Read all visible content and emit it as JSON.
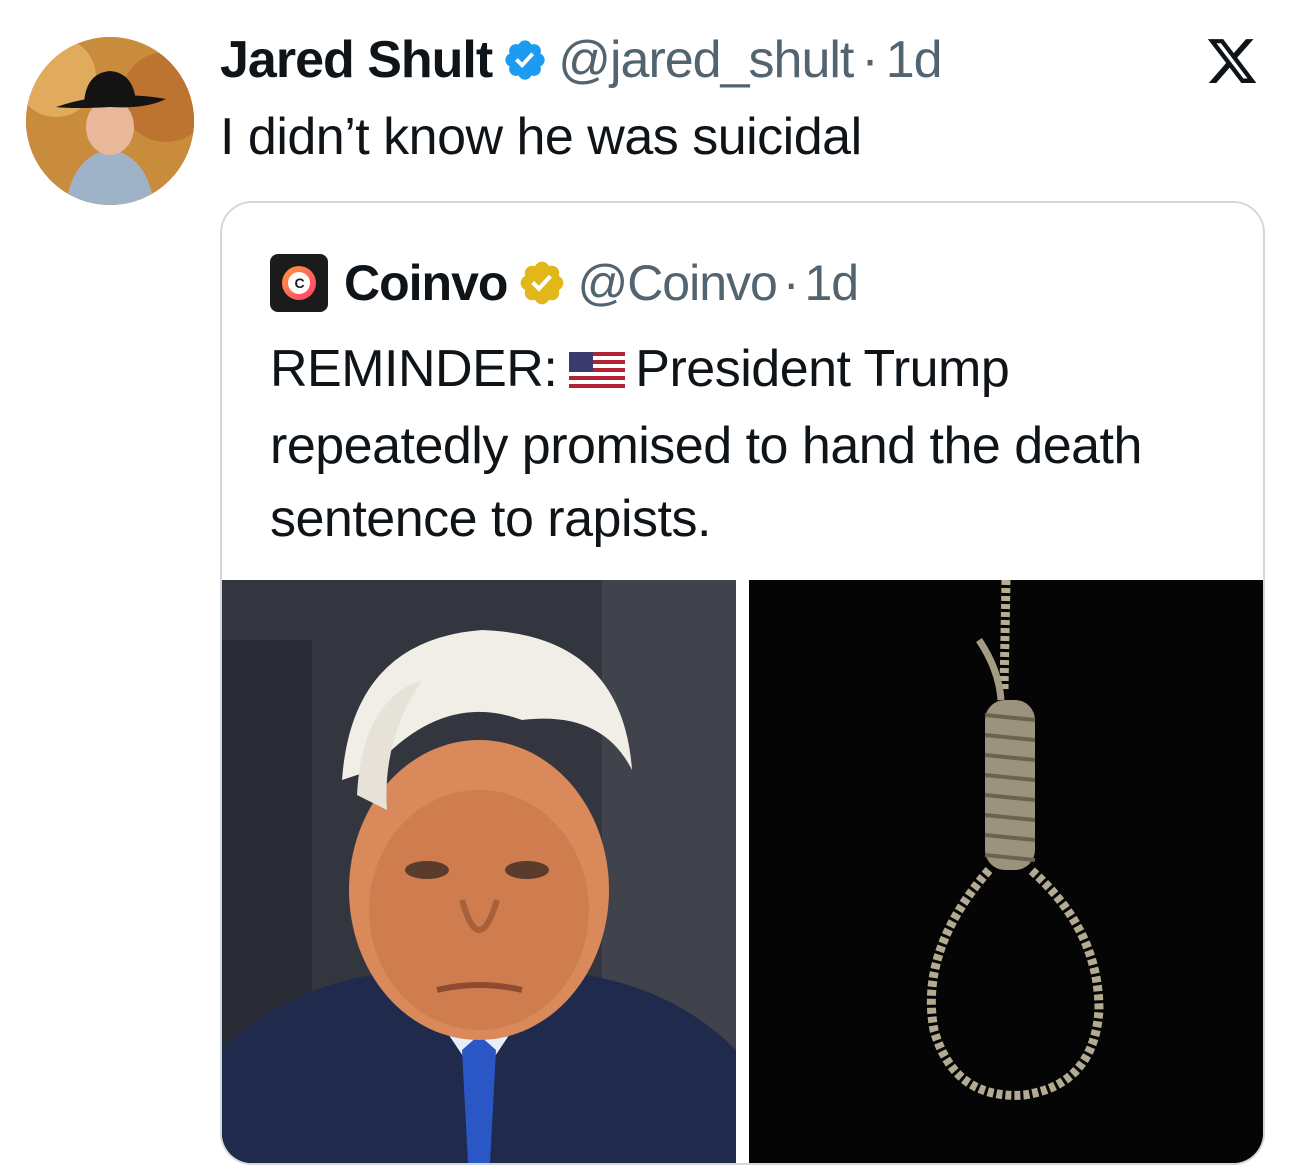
{
  "tweet": {
    "author_name": "Jared Shult",
    "handle": "@jared_shult",
    "separator": "·",
    "time": "1d",
    "text": "I didn’t know he was suicidal"
  },
  "brand_icon": "x-logo-icon",
  "quote": {
    "author_name": "Coinvo",
    "avatar_letter": "C",
    "handle": "@Coinvo",
    "separator": "·",
    "time": "1d",
    "text_prefix": "REMINDER:",
    "flag_icon": "us-flag-icon",
    "text_rest": "President Trump repeatedly promised to hand the death sentence to rapists.",
    "images": [
      "portrait-photo",
      "noose-photo"
    ]
  },
  "colors": {
    "verified_blue": "#1d9bf0",
    "verified_gold": "#e2b719",
    "secondary_text": "#536471",
    "border": "#cfd9de"
  }
}
